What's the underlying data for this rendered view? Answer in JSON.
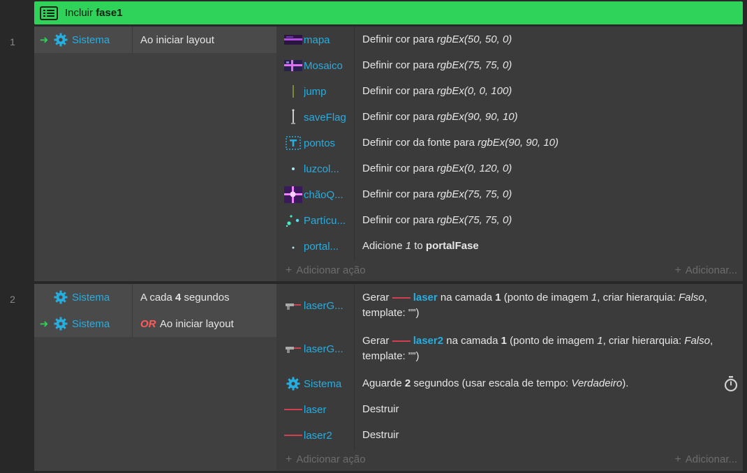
{
  "include": {
    "prefix": "Incluir",
    "name": "fase1",
    "icon": "list-icon"
  },
  "events": [
    {
      "number": "1",
      "conditions": [
        {
          "arrow": "➜",
          "object": "Sistema",
          "text": "Ao iniciar layout"
        }
      ],
      "actions": [
        {
          "object": "mapa",
          "icon": "tilemap-icon",
          "pre": "Definir cor para ",
          "expr": "rgbEx(50, 50, 0)"
        },
        {
          "object": "Mosaico",
          "icon": "tiled-bg-icon",
          "pre": "Definir cor para ",
          "expr": "rgbEx(75, 75, 0)"
        },
        {
          "object": "jump",
          "icon": "sprite-line-icon",
          "pre": "Definir cor para ",
          "expr": "rgbEx(0, 0, 100)"
        },
        {
          "object": "saveFlag",
          "icon": "flag-sprite-icon",
          "pre": "Definir cor para ",
          "expr": "rgbEx(90, 90, 10)"
        },
        {
          "object": "pontos",
          "icon": "text-object-icon",
          "pre": "Definir cor da fonte para ",
          "expr": "rgbEx(90, 90, 10)"
        },
        {
          "object": "luzcol...",
          "icon": "dot-sprite-icon",
          "pre": "Definir cor para ",
          "expr": "rgbEx(0, 120, 0)"
        },
        {
          "object": "chãoQ...",
          "icon": "floor-sprite-icon",
          "pre": "Definir cor para ",
          "expr": "rgbEx(75, 75, 0)"
        },
        {
          "object": "Partícu...",
          "icon": "particles-icon",
          "pre": "Definir cor para ",
          "expr": "rgbEx(75, 75, 0)"
        },
        {
          "object": "portal...",
          "icon": "portal-sprite-icon",
          "pre": "Adicione ",
          "num": "1",
          "mid": " to ",
          "bold": "portalFase"
        }
      ],
      "add_action": "Adicionar ação",
      "add_more": "Adicionar..."
    },
    {
      "number": "2",
      "conditions": [
        {
          "arrow": "",
          "object": "Sistema",
          "pre": "A cada ",
          "bold": "4",
          "post": " segundos"
        },
        {
          "arrow": "➜",
          "object": "Sistema",
          "or": "OR",
          "text": "Ao iniciar layout"
        }
      ],
      "actions": [
        {
          "object": "laserG...",
          "icon": "laser-gun-icon",
          "pre": "Gerar ",
          "ref": "laser",
          "a": " na camada ",
          "b1": "1",
          "c": " (ponto de imagem ",
          "i1": "1",
          "d": ", criar hierarquia: ",
          "i2": "Falso",
          "e": ", template: \"\")"
        },
        {
          "object": "laserG...",
          "icon": "laser-gun-icon",
          "pre": "Gerar ",
          "ref": "laser2",
          "a": " na camada ",
          "b1": "1",
          "c": " (ponto de imagem ",
          "i1": "1",
          "d": ", criar hierarquia: ",
          "i2": "Falso",
          "e": ", template: \"\")"
        },
        {
          "object": "Sistema",
          "icon": "gear-icon",
          "pre": "Aguarde ",
          "bold": "2",
          "post": " segundos (usar escala de tempo: ",
          "ital": "Verdadeiro",
          "end": ")."
        },
        {
          "object": "laser",
          "icon": "laser-beam-icon",
          "text": "Destruir"
        },
        {
          "object": "laser2",
          "icon": "laser-beam-icon",
          "text": "Destruir"
        }
      ],
      "add_action": "Adicionar ação",
      "add_more": "Adicionar..."
    }
  ]
}
